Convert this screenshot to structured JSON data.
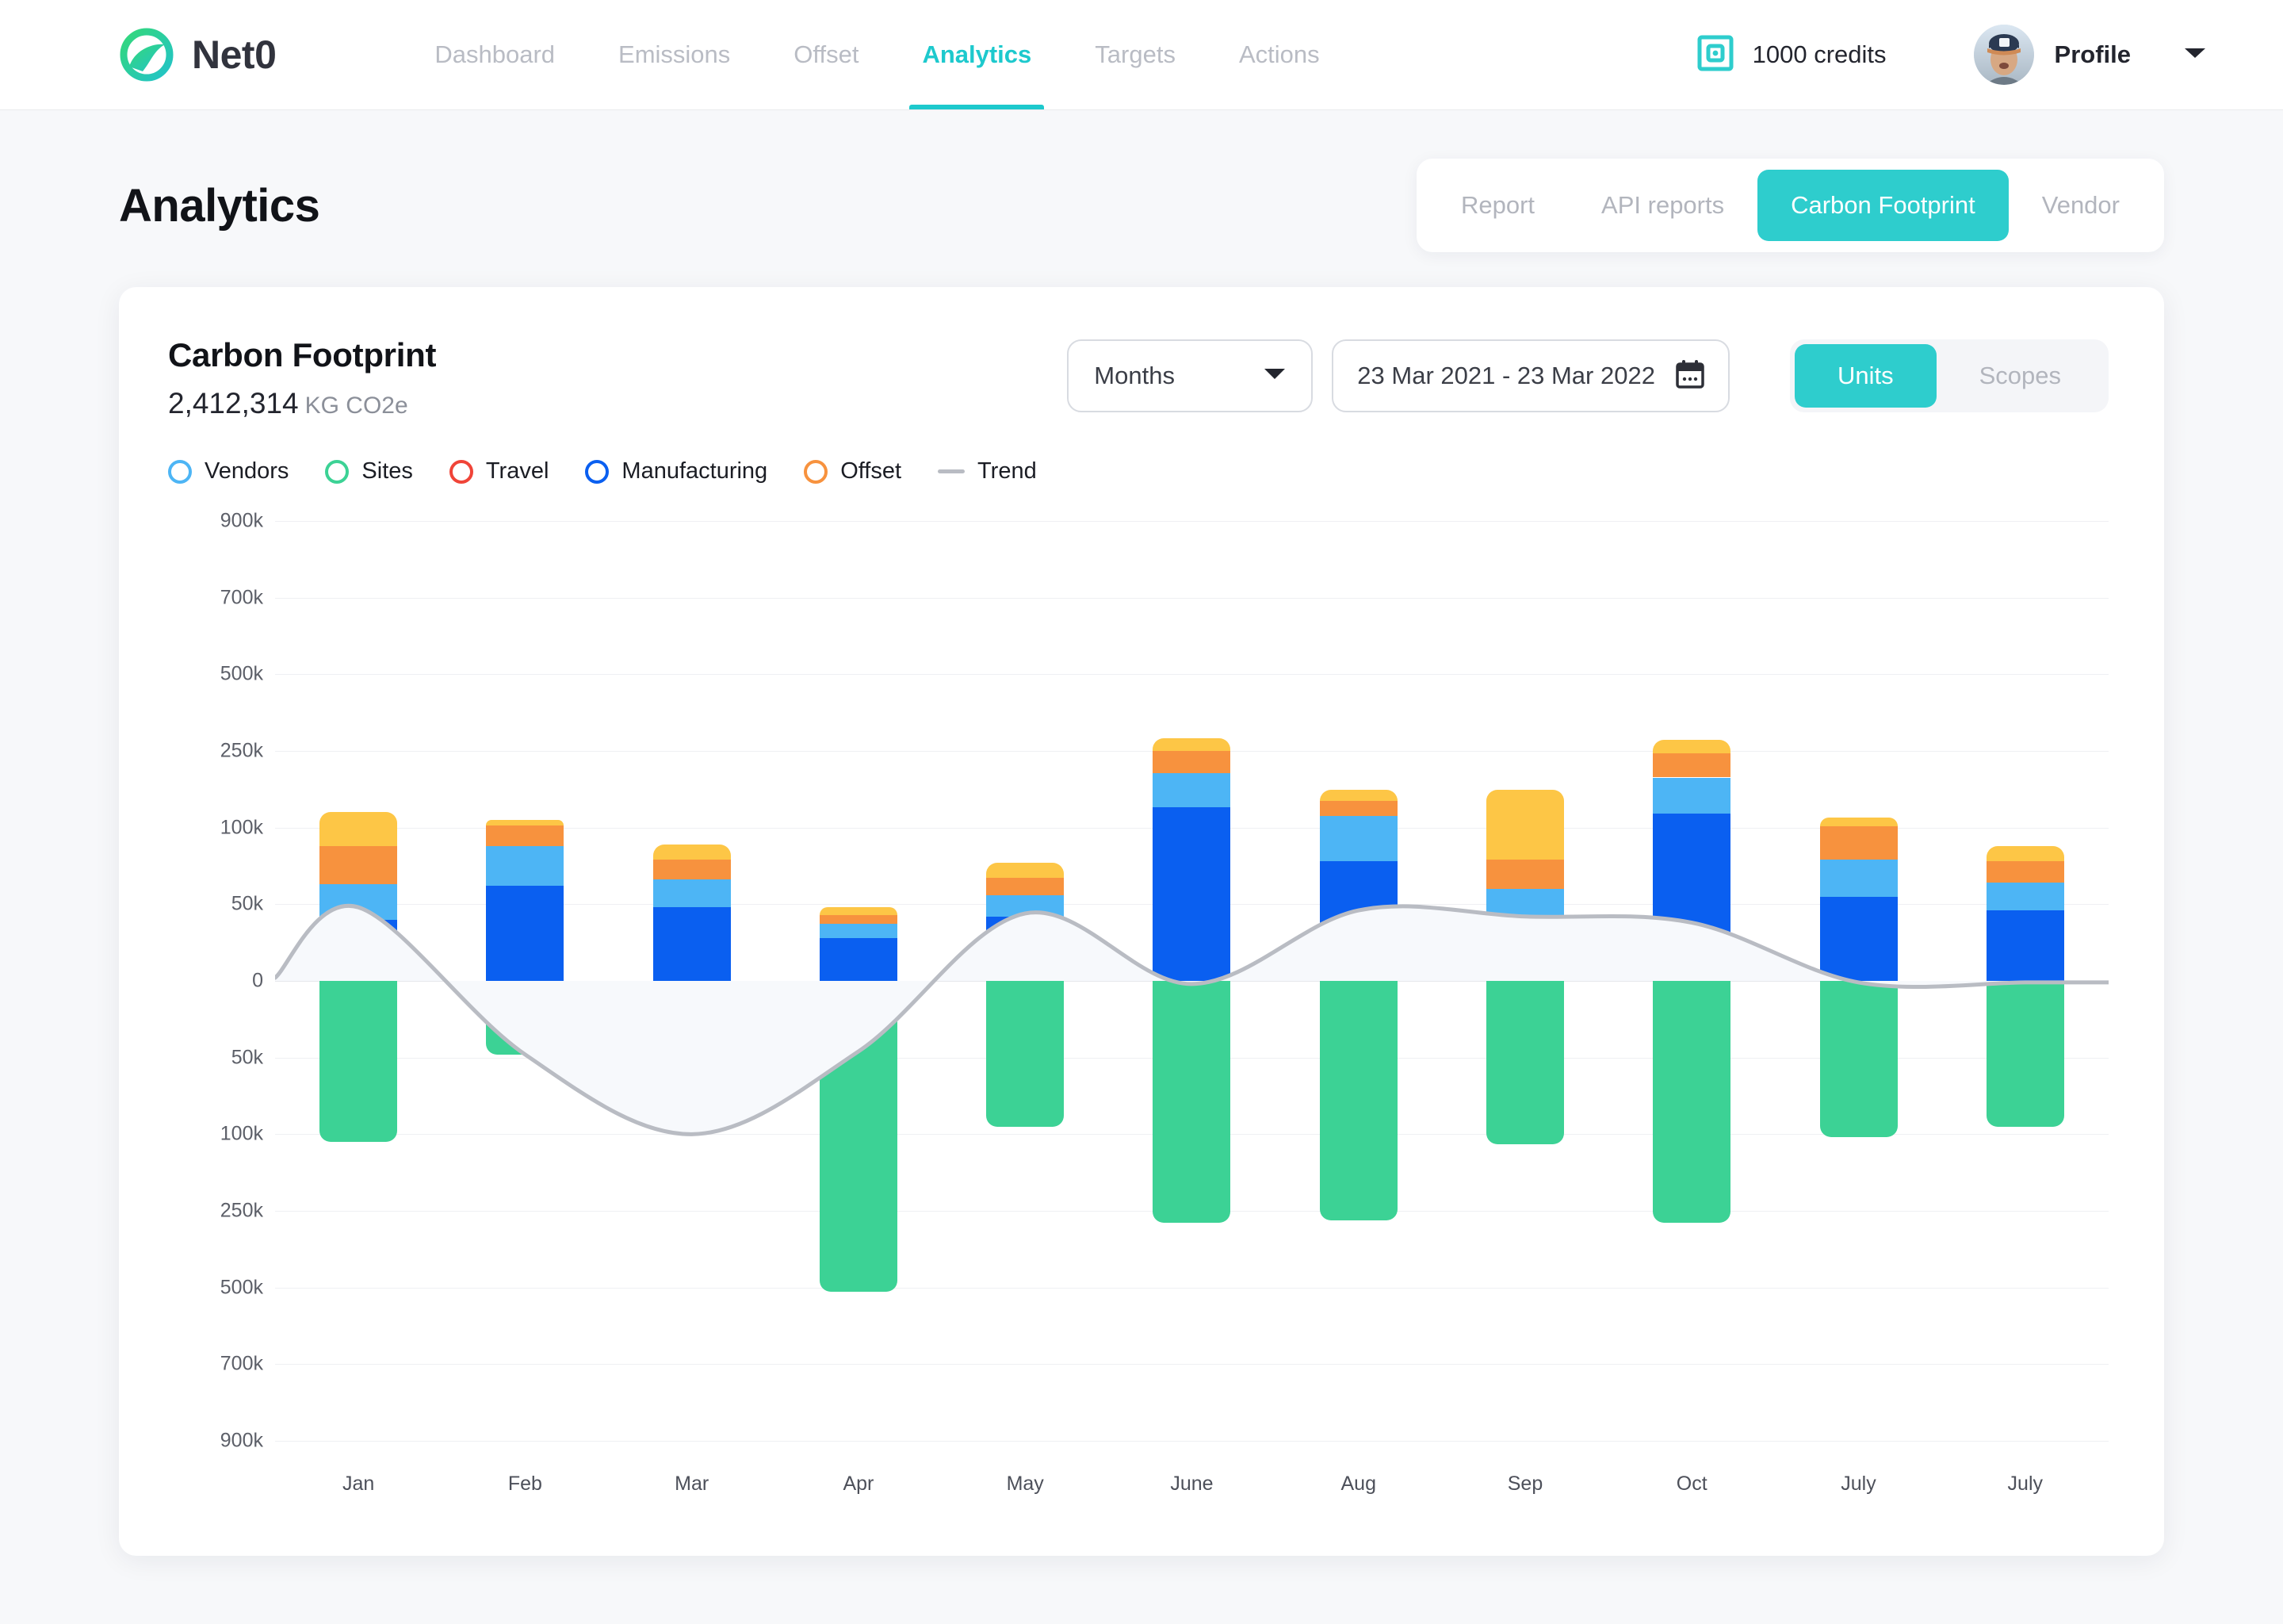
{
  "brand": {
    "name": "Net0"
  },
  "nav": {
    "items": [
      {
        "label": "Dashboard",
        "active": false
      },
      {
        "label": "Emissions",
        "active": false
      },
      {
        "label": "Offset",
        "active": false
      },
      {
        "label": "Analytics",
        "active": true
      },
      {
        "label": "Targets",
        "active": false
      },
      {
        "label": "Actions",
        "active": false
      }
    ],
    "credits_label": "1000 credits",
    "profile_label": "Profile"
  },
  "page": {
    "title": "Analytics",
    "tabs": [
      {
        "label": "Report",
        "active": false
      },
      {
        "label": "API reports",
        "active": false
      },
      {
        "label": "Carbon Footprint",
        "active": true
      },
      {
        "label": "Vendor",
        "active": false
      }
    ]
  },
  "card": {
    "title": "Carbon Footprint",
    "value": "2,412,314",
    "unit": "KG CO2e",
    "period_select": "Months",
    "date_range": "23 Mar 2021 - 23 Mar 2022",
    "mode_units": "Units",
    "mode_scopes": "Scopes"
  },
  "colors": {
    "accent": "#2ecdcd",
    "vendors": "#4DB5F5",
    "sites": "#3CD295",
    "travel": "#F04438",
    "manufacturing": "#0A5FF0",
    "offset": "#F7923E",
    "trend": "#b9bcc3",
    "yellow": "#FDC646"
  },
  "chart_data": {
    "type": "bar",
    "title": "Carbon Footprint",
    "subtitle": "2,412,314 KG CO2e",
    "xlabel": "",
    "ylabel": "",
    "grid": true,
    "legend_position": "top-left",
    "legend": [
      {
        "label": "Vendors",
        "color": "#4DB5F5",
        "style": "ring"
      },
      {
        "label": "Sites",
        "color": "#3CD295",
        "style": "ring"
      },
      {
        "label": "Travel",
        "color": "#F04438",
        "style": "ring"
      },
      {
        "label": "Manufacturing",
        "color": "#0A5FF0",
        "style": "ring"
      },
      {
        "label": "Offset",
        "color": "#F7923E",
        "style": "ring"
      },
      {
        "label": "Trend",
        "color": "#b9bcc3",
        "style": "line"
      }
    ],
    "ytick_labels": [
      "900k",
      "700k",
      "500k",
      "250k",
      "100k",
      "50k",
      "0",
      "50k",
      "100k",
      "250k",
      "500k",
      "700k",
      "900k"
    ],
    "ytick_values": [
      900000,
      700000,
      500000,
      250000,
      100000,
      50000,
      0,
      -50000,
      -100000,
      -250000,
      -500000,
      -700000,
      -900000
    ],
    "categories": [
      "Jan",
      "Feb",
      "Mar",
      "Apr",
      "May",
      "June",
      "Aug",
      "Sep",
      "Oct",
      "July",
      "July"
    ],
    "series": [
      {
        "name": "Manufacturing",
        "color": "#0A5FF0",
        "values": [
          40000,
          62000,
          48000,
          28000,
          42000,
          140000,
          78000,
          38000,
          128000,
          55000,
          46000
        ]
      },
      {
        "name": "Vendors",
        "color": "#4DB5F5",
        "values": [
          23000,
          26000,
          18000,
          9000,
          14000,
          66000,
          44000,
          22000,
          70000,
          24000,
          18000
        ]
      },
      {
        "name": "Offset",
        "color": "#F7923E",
        "values": [
          25000,
          16000,
          13000,
          6000,
          11000,
          45000,
          30000,
          19000,
          48000,
          24000,
          14000
        ]
      },
      {
        "name": "Travel",
        "color": "#FDC646",
        "values": [
          42000,
          11000,
          10000,
          5000,
          10000,
          40000,
          22000,
          95000,
          40000,
          16000,
          10000
        ]
      },
      {
        "name": "Sites",
        "color": "#3CD295",
        "values": [
          -115000,
          -48000,
          -92000,
          -510000,
          -95000,
          -290000,
          -280000,
          -120000,
          -290000,
          -105000,
          -95000
        ]
      }
    ],
    "trend": {
      "name": "Trend",
      "color": "#b9bcc3",
      "values": [
        2000,
        48000,
        -48000,
        -100000,
        -46000,
        44000,
        -2000,
        46000,
        42000,
        38000,
        -1000,
        -1000
      ]
    }
  }
}
